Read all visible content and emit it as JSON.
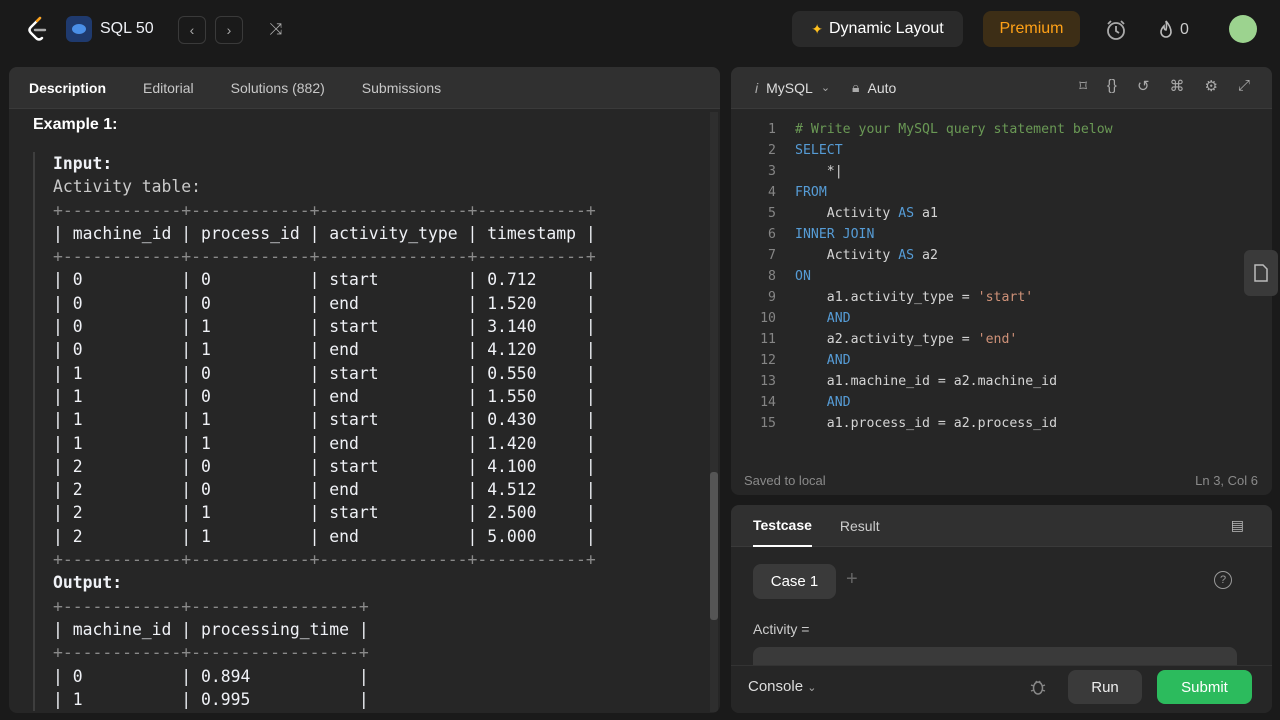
{
  "topbar": {
    "list_title": "SQL 50",
    "prev": "‹",
    "next": "›",
    "shuffle": "⤨",
    "dynamic_layout": "Dynamic Layout",
    "premium": "Premium",
    "streak_count": "0"
  },
  "left": {
    "tabs": [
      "Description",
      "Editorial",
      "Solutions (882)",
      "Submissions"
    ],
    "example_title": "Example 1:",
    "input_label": "Input:",
    "table_caption": "Activity table:",
    "input_sep": "+------------+------------+---------------+-----------+",
    "input_header": "| machine_id | process_id | activity_type | timestamp |",
    "input_rows": [
      "| 0          | 0          | start         | 0.712     |",
      "| 0          | 0          | end           | 1.520     |",
      "| 0          | 1          | start         | 3.140     |",
      "| 0          | 1          | end           | 4.120     |",
      "| 1          | 0          | start         | 0.550     |",
      "| 1          | 0          | end           | 1.550     |",
      "| 1          | 1          | start         | 0.430     |",
      "| 1          | 1          | end           | 1.420     |",
      "| 2          | 0          | start         | 4.100     |",
      "| 2          | 0          | end           | 4.512     |",
      "| 2          | 1          | start         | 2.500     |",
      "| 2          | 1          | end           | 5.000     |"
    ],
    "output_label": "Output:",
    "output_sep": "+------------+-----------------+",
    "output_header": "| machine_id | processing_time |",
    "output_rows": [
      "| 0          | 0.894           |",
      "| 1          | 0.995           |"
    ]
  },
  "editor": {
    "language": "MySQL",
    "mode": "Auto",
    "lines": [
      {
        "n": "1",
        "text": "# Write your MySQL query statement below"
      },
      {
        "n": "2",
        "text": "SELECT"
      },
      {
        "n": "3",
        "text": "    *|"
      },
      {
        "n": "4",
        "text": "FROM"
      },
      {
        "n": "5",
        "text": "    Activity AS a1"
      },
      {
        "n": "6",
        "text": "INNER JOIN"
      },
      {
        "n": "7",
        "text": "    Activity AS a2"
      },
      {
        "n": "8",
        "text": "ON"
      },
      {
        "n": "9",
        "text": "    a1.activity_type = 'start'"
      },
      {
        "n": "10",
        "text": "    AND"
      },
      {
        "n": "11",
        "text": "    a2.activity_type = 'end'"
      },
      {
        "n": "12",
        "text": "    AND"
      },
      {
        "n": "13",
        "text": "    a1.machine_id = a2.machine_id"
      },
      {
        "n": "14",
        "text": "    AND"
      },
      {
        "n": "15",
        "text": "    a1.process_id = a2.process_id"
      }
    ],
    "saved": "Saved to local",
    "cursor_pos": "Ln 3, Col 6"
  },
  "bottom": {
    "tabs": [
      "Testcase",
      "Result"
    ],
    "case_label": "Case 1",
    "activity_label": "Activity =",
    "console": "Console",
    "run": "Run",
    "submit": "Submit"
  }
}
